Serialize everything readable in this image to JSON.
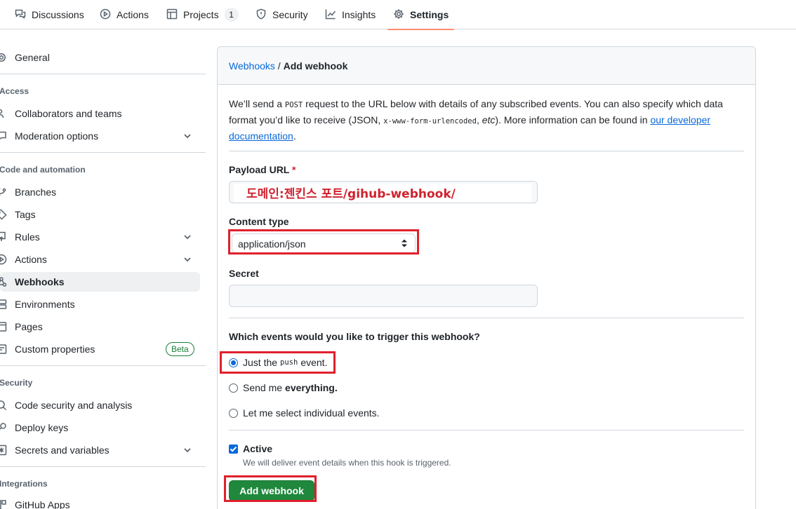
{
  "topnav": {
    "tabs": [
      {
        "label": "Discussions",
        "icon": "comment-discussion-icon"
      },
      {
        "label": "Actions",
        "icon": "play-icon"
      },
      {
        "label": "Projects",
        "icon": "table-icon",
        "count": "1"
      },
      {
        "label": "Security",
        "icon": "shield-icon"
      },
      {
        "label": "Insights",
        "icon": "graph-icon"
      },
      {
        "label": "Settings",
        "icon": "gear-icon",
        "active": true
      }
    ]
  },
  "sidebar": {
    "general": "General",
    "access_heading": "Access",
    "collaborators": "Collaborators and teams",
    "moderation": "Moderation options",
    "code_heading": "Code and automation",
    "branches": "Branches",
    "tags": "Tags",
    "rules": "Rules",
    "actions": "Actions",
    "webhooks": "Webhooks",
    "environments": "Environments",
    "pages": "Pages",
    "custom_properties": "Custom properties",
    "beta": "Beta",
    "security_heading": "Security",
    "code_security": "Code security and analysis",
    "deploy_keys": "Deploy keys",
    "secrets": "Secrets and variables",
    "integrations_heading": "Integrations",
    "github_apps": "GitHub Apps"
  },
  "breadcrumb": {
    "parent": "Webhooks",
    "separator": " / ",
    "current": "Add webhook"
  },
  "description": {
    "part1": "We’ll send a ",
    "code1": "POST",
    "part2": " request to the URL below with details of any subscribed events. You can also specify which data format you’d like to receive (JSON, ",
    "code2": "x-www-form-urlencoded",
    "part3": ", ",
    "etc": "etc",
    "part4": "). More information can be found in ",
    "link": "our developer documentation",
    "part5": "."
  },
  "form": {
    "payload_label": "Payload URL",
    "required_mark": "*",
    "payload_value": "도메인:젠킨스 포트/gihub-webhook/",
    "content_type_label": "Content type",
    "content_type_value": "application/json",
    "secret_label": "Secret",
    "secret_value": "",
    "events_question": "Which events would you like to trigger this webhook?",
    "event_push_pre": "Just the",
    "event_push_code": "push",
    "event_push_post": "event.",
    "event_everything_pre": "Send me",
    "event_everything_bold": "everything.",
    "event_individual": "Let me select individual events.",
    "selected_event": "push",
    "active_label": "Active",
    "active_checked": true,
    "active_note": "We will deliver event details when this hook is triggered.",
    "submit_label": "Add webhook"
  },
  "colors": {
    "accent": "#0969da",
    "highlight": "#e0202c",
    "button": "#1f883d",
    "tab_underline": "#fd8c73"
  }
}
